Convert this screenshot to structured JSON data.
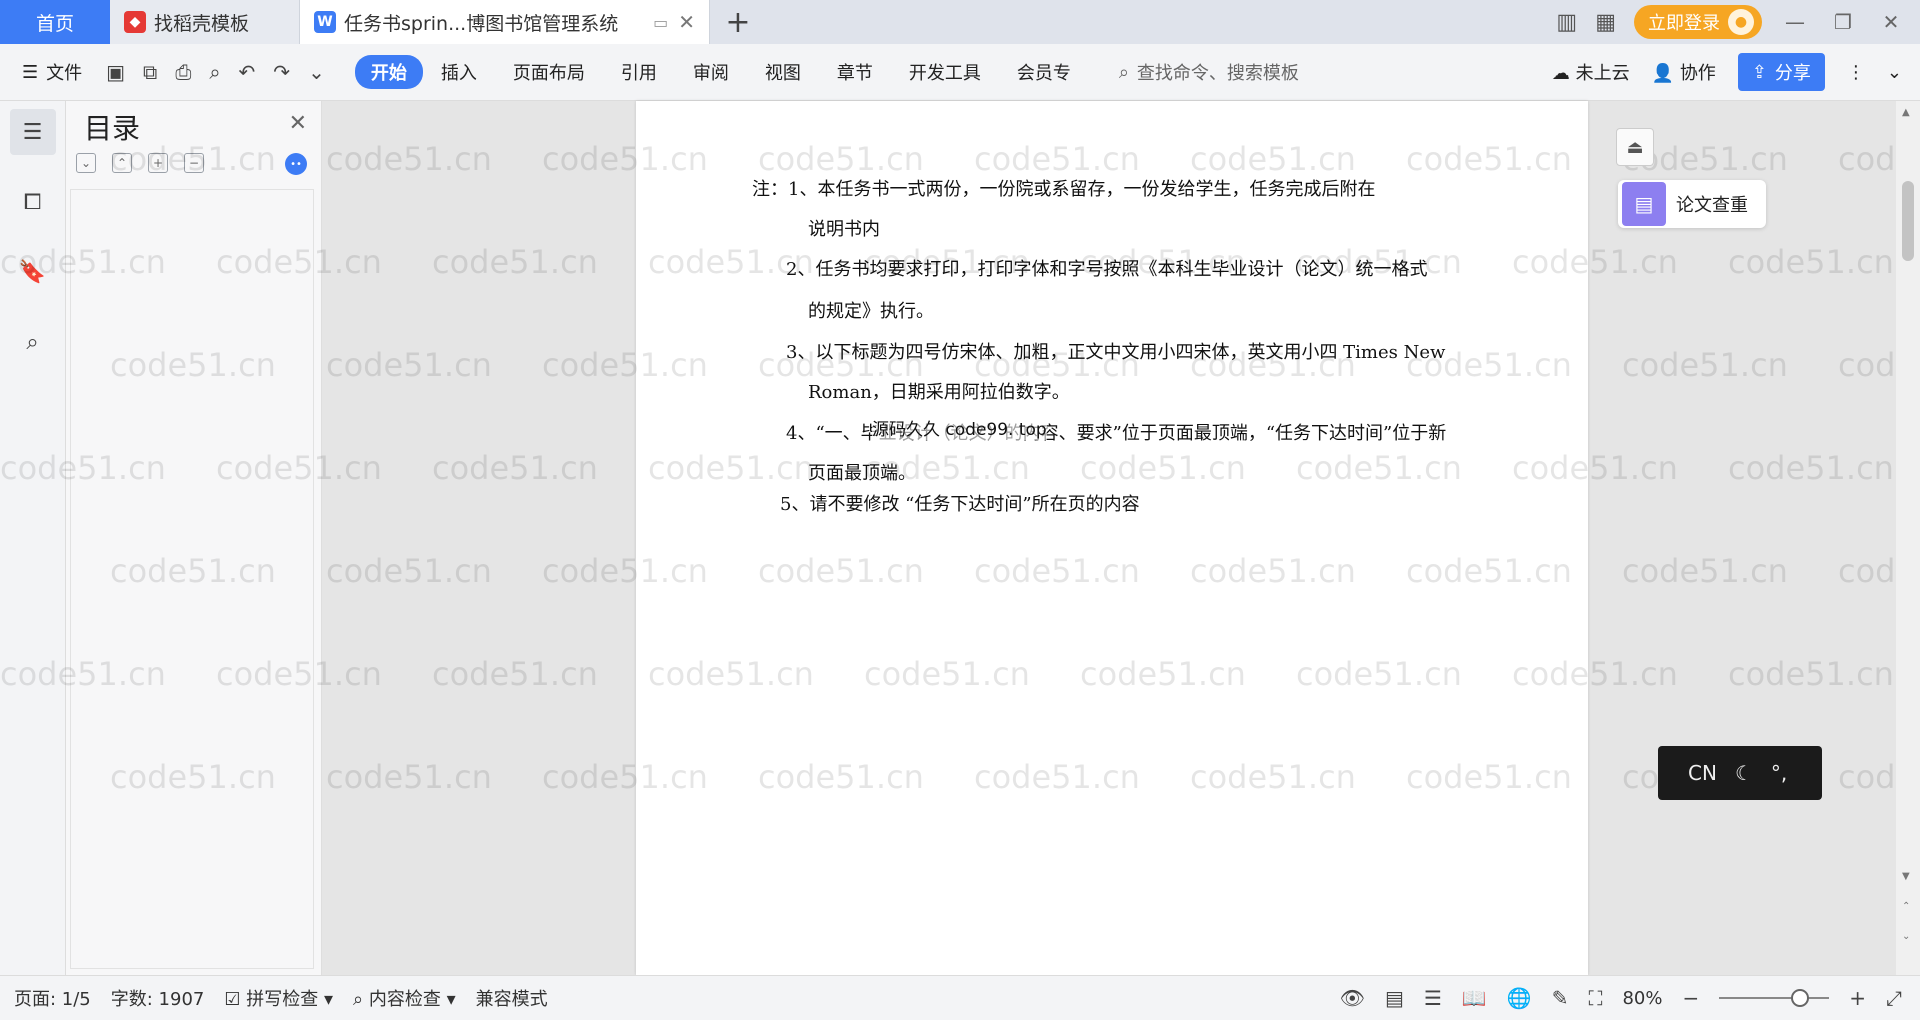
{
  "tabs": {
    "home": "首页",
    "templates": "找稻壳模板",
    "document": "任务书sprin...博图书馆管理系统"
  },
  "titlebar": {
    "login": "立即登录"
  },
  "toolbar": {
    "file": "文件",
    "menus": [
      "开始",
      "插入",
      "页面布局",
      "引用",
      "审阅",
      "视图",
      "章节",
      "开发工具",
      "会员专"
    ],
    "search_placeholder": "查找命令、搜索模板",
    "cloud": "未上云",
    "collab": "协作",
    "share": "分享"
  },
  "toc": {
    "title": "目录"
  },
  "document": {
    "lines": [
      "注：1、本任务书一式两份，一份院或系留存，一份发给学生，任务完成后附在",
      "说明书内",
      "2、任务书均要求打印，打印字体和字号按照《本科生毕业设计（论文）统一格式",
      "的规定》执行。",
      "3、以下标题为四号仿宋体、加粗，正文中文用小四宋体，英文用小四 Times New",
      "Roman，日期采用阿拉伯数字。",
      "4、“一、毕业设计（论文）的内容、要求”位于页面最顶端，“任务下达时间”位于新",
      "页面最顶端。",
      "5、请不要修改 “任务下达时间”所在页的内容"
    ],
    "overlay_text": "源码久久 code99. top"
  },
  "watermark": "code51.cn",
  "side": {
    "paper_check": "论文查重",
    "ime_lang": "CN"
  },
  "status": {
    "page": "页面: 1/5",
    "words": "字数: 1907",
    "spell": "拼写检查",
    "content_check": "内容检查",
    "compat": "兼容模式",
    "zoom": "80%"
  },
  "colors": {
    "accent": "#3d7cf5",
    "login": "#f6a623",
    "paper_check_icon": "#8d7ff0"
  }
}
